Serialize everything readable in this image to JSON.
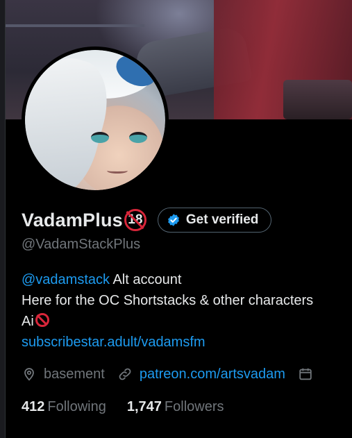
{
  "profile": {
    "display_name": "VadamPlus",
    "name_badge_number": "18",
    "verify_button_label": "Get verified",
    "handle": "@VadamStackPlus",
    "bio": {
      "mention": "@vadamstack",
      "line1_rest": " Alt account",
      "line2": "Here for the OC Shortstacks & other characters",
      "line3": "Ai",
      "link": "subscribestar.adult/vadamsfm"
    },
    "location": "basement",
    "website": "patreon.com/artsvadam",
    "following_count": "412",
    "following_label": "Following",
    "followers_count": "1,747",
    "followers_label": "Followers"
  },
  "icons": {
    "verified": "verified-badge-icon",
    "location": "location-pin-icon",
    "link": "link-icon",
    "calendar": "calendar-icon",
    "no_entry": "no-entry-icon"
  },
  "colors": {
    "background": "#000000",
    "text_primary": "#e7e9ea",
    "text_secondary": "#71767b",
    "link": "#1d9bf0",
    "prohibited_red": "#d8263a"
  }
}
